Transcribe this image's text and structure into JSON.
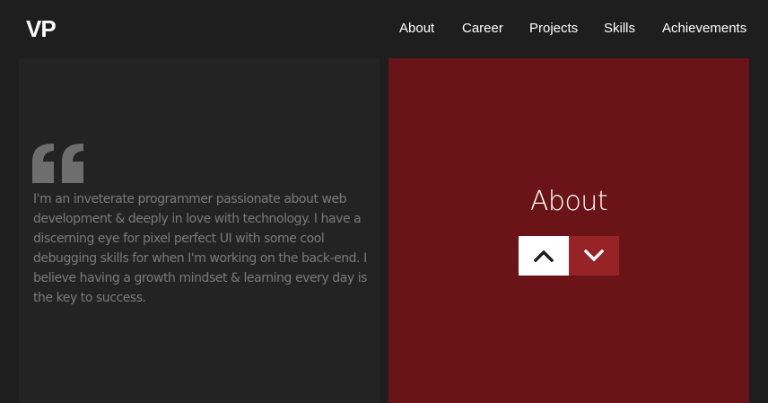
{
  "brand": {
    "logo": "VP"
  },
  "nav": {
    "items": [
      {
        "label": "About"
      },
      {
        "label": "Career"
      },
      {
        "label": "Projects"
      },
      {
        "label": "Skills"
      },
      {
        "label": "Achievements"
      }
    ]
  },
  "intro": {
    "quote_icon": "quote-icon",
    "text_lines": [
      "I'm an inveterate programmer passionate about web",
      "development & deeply in love with technology. I have a",
      "discerning eye for pixel perfect UI with some cool",
      "debugging skills for when I'm working on the back-end. I",
      "believe having a growth mindset & learning every day is",
      "the key to success."
    ]
  },
  "section": {
    "title": "About",
    "up_icon": "chevron-up-icon",
    "down_icon": "chevron-down-icon"
  },
  "colors": {
    "page_bg": "#1e1e1e",
    "panel_left_bg": "#232323",
    "accent_panel": "#6b1418",
    "down_button": "#962325",
    "quote_text": "#7a7a7a"
  }
}
